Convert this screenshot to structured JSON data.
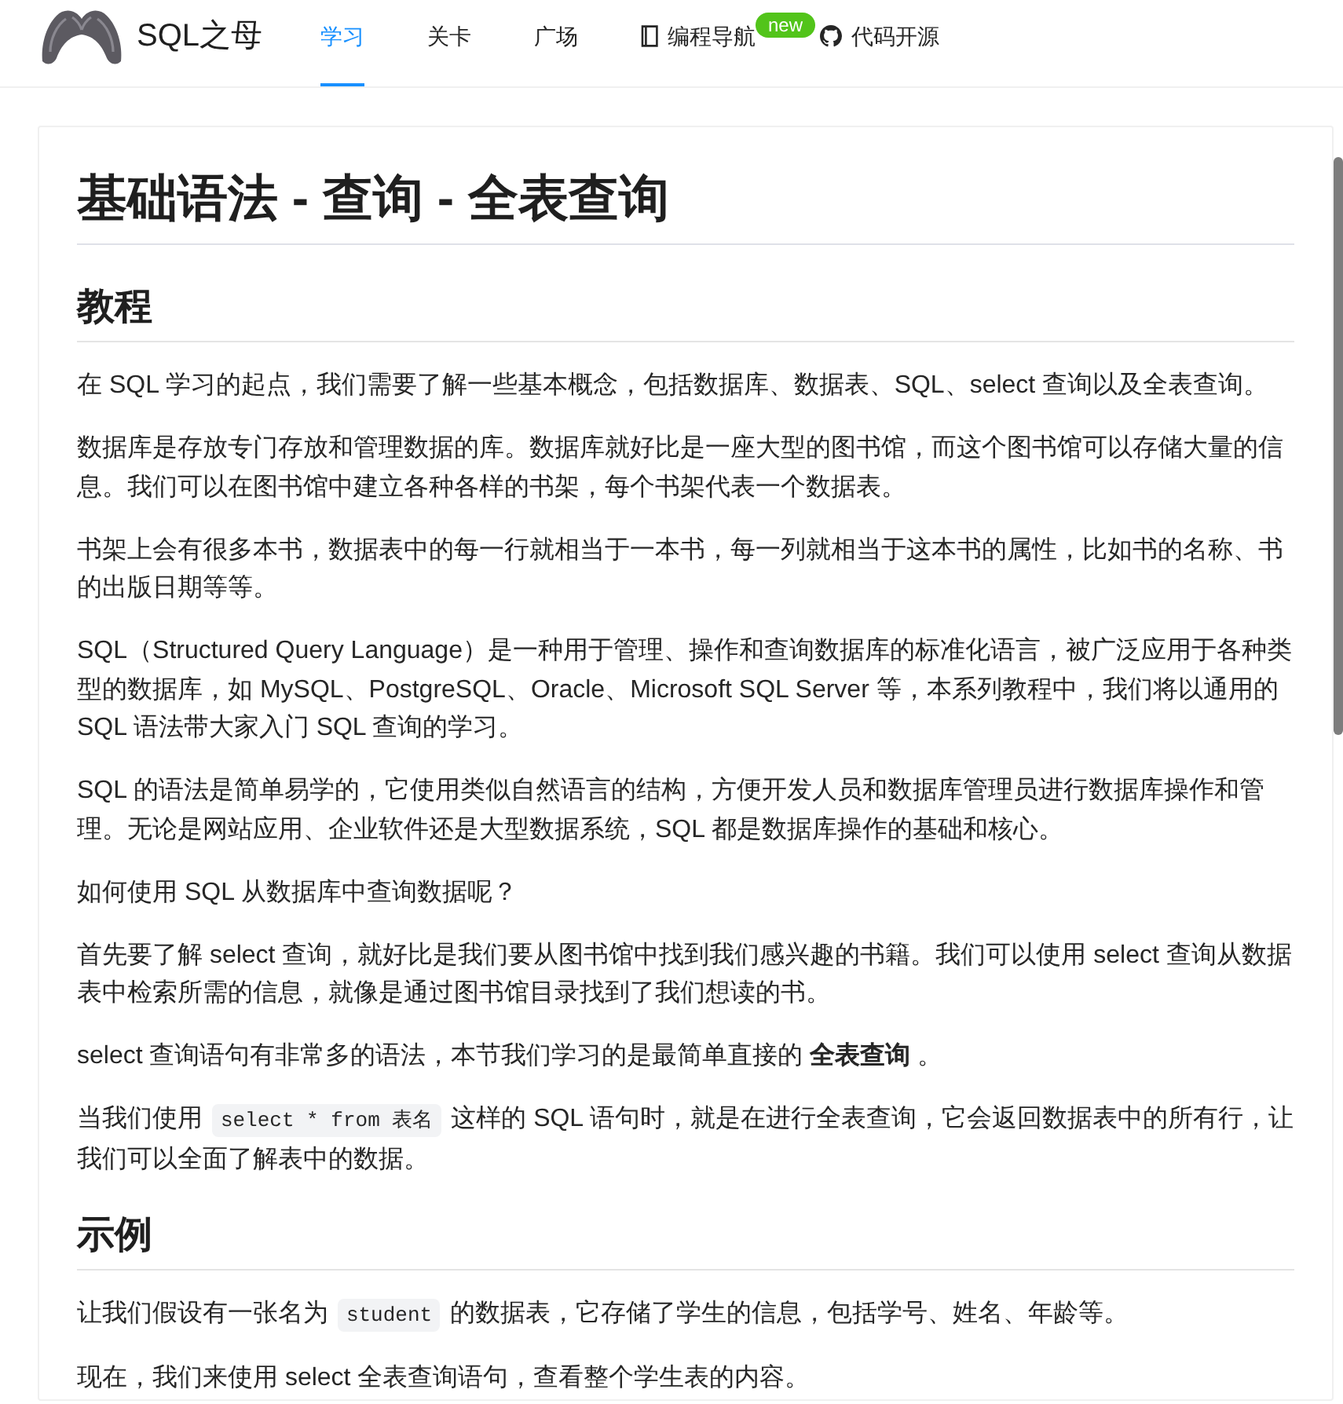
{
  "header": {
    "site_name": "SQL之母",
    "nav": [
      {
        "label": "学习",
        "kind": "plain",
        "selected": true
      },
      {
        "label": "关卡",
        "kind": "plain",
        "selected": false
      },
      {
        "label": "广场",
        "kind": "plain",
        "selected": false
      },
      {
        "label": "编程导航",
        "kind": "guide",
        "selected": false,
        "badge": "new"
      },
      {
        "label": "代码开源",
        "kind": "source",
        "selected": false
      }
    ]
  },
  "article": {
    "title": "基础语法 - 查询 - 全表查询",
    "sections": [
      {
        "heading": "教程",
        "paragraphs": [
          {
            "text": "在 SQL 学习的起点，我们需要了解一些基本概念，包括数据库、数据表、SQL、select 查询以及全表查询。"
          },
          {
            "text": "数据库是存放专门存放和管理数据的库。数据库就好比是一座大型的图书馆，而这个图书馆可以存储大量的信息。我们可以在图书馆中建立各种各样的书架，每个书架代表一个数据表。"
          },
          {
            "text": "书架上会有很多本书，数据表中的每一行就相当于一本书，每一列就相当于这本书的属性，比如书的名称、书的出版日期等等。"
          },
          {
            "text": "SQL（Structured Query Language）是一种用于管理、操作和查询数据库的标准化语言，被广泛应用于各种类型的数据库，如 MySQL、PostgreSQL、Oracle、Microsoft SQL Server 等，本系列教程中，我们将以通用的 SQL 语法带大家入门 SQL 查询的学习。"
          },
          {
            "text": "SQL 的语法是简单易学的，它使用类似自然语言的结构，方便开发人员和数据库管理员进行数据库操作和管理。无论是网站应用、企业软件还是大型数据系统，SQL 都是数据库操作的基础和核心。"
          },
          {
            "text": "如何使用 SQL 从数据库中查询数据呢？"
          },
          {
            "text": "首先要了解 select 查询，就好比是我们要从图书馆中找到我们感兴趣的书籍。我们可以使用 select 查询从数据表中检索所需的信息，就像是通过图书馆目录找到了我们想读的书。"
          },
          {
            "text": "select 查询语句有非常多的语法，本节我们学习的是最简单直接的 **全表查询** 。"
          },
          {
            "parts": [
              {
                "kind": "text",
                "text": "当我们使用 "
              },
              {
                "kind": "code",
                "text": "select * from 表名"
              },
              {
                "kind": "text",
                "text": " 这样的 SQL 语句时，就是在进行全表查询，它会返回数据表中的所有行，让我们可以全面了解表中的数据。"
              }
            ]
          }
        ]
      },
      {
        "heading": "示例",
        "paragraphs": [
          {
            "parts": [
              {
                "kind": "text",
                "text": "让我们假设有一张名为 "
              },
              {
                "kind": "code",
                "text": "student"
              },
              {
                "kind": "text",
                "text": " 的数据表，它存储了学生的信息，包括学号、姓名、年龄等。"
              }
            ]
          },
          {
            "text": "现在，我们来使用 select 全表查询语句，查看整个学生表的内容。"
          }
        ]
      }
    ]
  }
}
